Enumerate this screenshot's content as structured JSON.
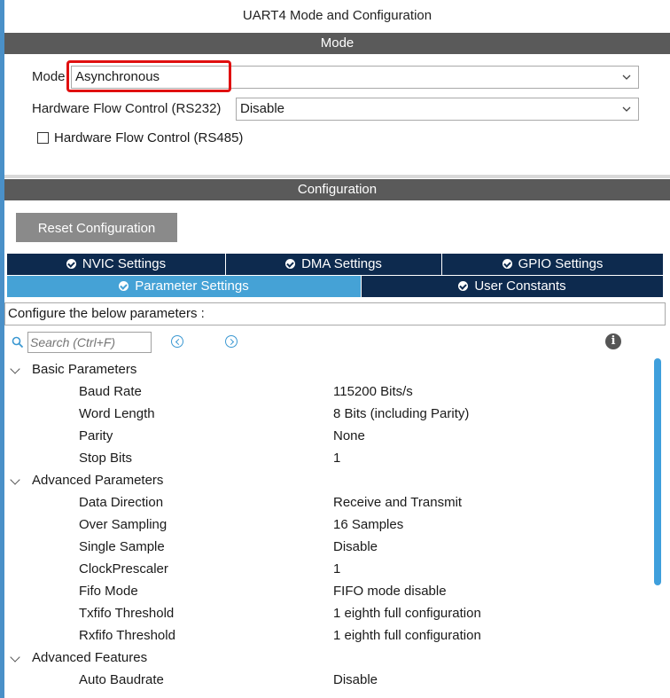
{
  "window": {
    "title": "UART4 Mode and Configuration"
  },
  "mode_section": {
    "header": "Mode",
    "mode_label": "Mode",
    "mode_value": "Asynchronous",
    "hw_flow_label": "Hardware Flow Control (RS232)",
    "hw_flow_value": "Disable",
    "rs485_label": "Hardware Flow Control (RS485)",
    "rs485_checked": false
  },
  "config_section": {
    "header": "Configuration",
    "reset_button": "Reset Configuration",
    "tabs_row1": [
      {
        "label": "NVIC Settings",
        "active": false
      },
      {
        "label": "DMA Settings",
        "active": false
      },
      {
        "label": "GPIO Settings",
        "active": false
      }
    ],
    "tabs_row2": [
      {
        "label": "Parameter Settings",
        "active": true
      },
      {
        "label": "User Constants",
        "active": false
      }
    ],
    "info_text": "Configure the below parameters :",
    "search_placeholder": "Search (Ctrl+F)"
  },
  "tree": {
    "groups": [
      {
        "label": "Basic Parameters",
        "params": [
          {
            "name": "Baud Rate",
            "value": "115200 Bits/s"
          },
          {
            "name": "Word Length",
            "value": "8 Bits (including Parity)"
          },
          {
            "name": "Parity",
            "value": "None"
          },
          {
            "name": "Stop Bits",
            "value": "1"
          }
        ]
      },
      {
        "label": "Advanced Parameters",
        "params": [
          {
            "name": "Data Direction",
            "value": "Receive and Transmit"
          },
          {
            "name": "Over Sampling",
            "value": "16 Samples"
          },
          {
            "name": "Single Sample",
            "value": "Disable"
          },
          {
            "name": "ClockPrescaler",
            "value": "1"
          },
          {
            "name": "Fifo Mode",
            "value": "FIFO mode disable"
          },
          {
            "name": "Txfifo Threshold",
            "value": "1 eighth full configuration"
          },
          {
            "name": "Rxfifo Threshold",
            "value": "1 eighth full configuration"
          }
        ]
      },
      {
        "label": "Advanced Features",
        "params": [
          {
            "name": "Auto Baudrate",
            "value": "Disable"
          }
        ]
      }
    ]
  },
  "colors": {
    "section_header_bg": "#5a5a5a",
    "tab_bg": "#0d2a4e",
    "tab_active_bg": "#45a2d6",
    "highlight_border": "#e01010",
    "accent": "#3b98d2"
  }
}
